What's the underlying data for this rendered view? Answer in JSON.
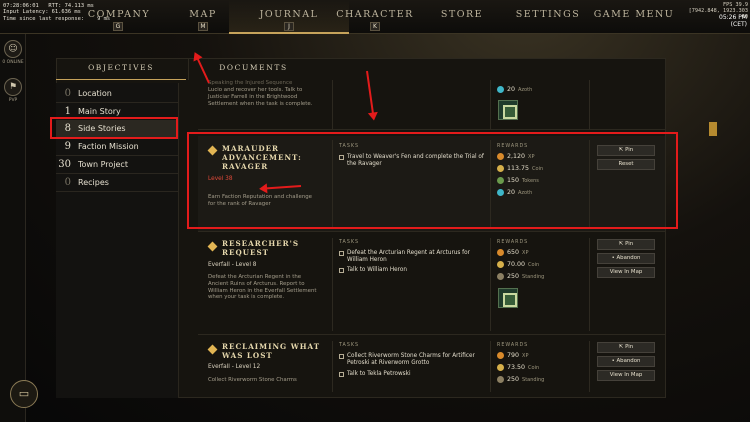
{
  "debug": {
    "lines": [
      "07:28:06:01   RTT: 74.113 ms",
      "Input Latency: 61.636 ms",
      "Time since last response:    9 ms"
    ]
  },
  "fps": {
    "lines": [
      "FPS 39.9",
      "[7942.848, 1923.303",
      "00"
    ]
  },
  "clock": {
    "time": "05:26 PM",
    "zone": "(CET)"
  },
  "nav": [
    {
      "label": "COMPANY",
      "key": "G"
    },
    {
      "label": "MAP",
      "key": "M"
    },
    {
      "label": "JOURNAL",
      "key": "J"
    },
    {
      "label": "CHARACTER",
      "key": "K"
    },
    {
      "label": "STORE",
      "key": ""
    },
    {
      "label": "SETTINGS",
      "key": ""
    },
    {
      "label": "GAME MENU",
      "key": ""
    }
  ],
  "leftbar": {
    "online": "0 ONLINE",
    "mode": "PVP"
  },
  "tabs": {
    "objectives": "OBJECTIVES",
    "documents": "DOCUMENTS"
  },
  "objectives": [
    {
      "count": "0",
      "label": "Location",
      "dim": true
    },
    {
      "count": "1",
      "label": "Main Story",
      "dim": false
    },
    {
      "count": "8",
      "label": "Side Stories",
      "dim": false
    },
    {
      "count": "9",
      "label": "Faction Mission",
      "dim": false
    },
    {
      "count": "30",
      "label": "Town Project",
      "dim": false
    },
    {
      "count": "0",
      "label": "Recipes",
      "dim": true
    }
  ],
  "quest0": {
    "desc": "Lucio and recover her tools. Talk to Justiciar Farrell in the Brightwood Settlement when the task is complete.",
    "cut": "Speaking the Injured Sequence",
    "azoth": "20",
    "azoth_label": "Azoth"
  },
  "quest1": {
    "title1": "MARAUDER",
    "title2": "ADVANCEMENT:",
    "title3": "RAVAGER",
    "level": "Level 38",
    "desc": "Earn Faction Reputation and challenge for the rank of Ravager",
    "tasks_head": "TASKS",
    "task1": "Travel to Weaver's Fen and complete the Trial of the Ravager",
    "rewards_head": "REWARDS",
    "xp": "2,120",
    "xp_label": "XP",
    "coin": "113.75",
    "coin_label": "Coin",
    "tokens": "150",
    "tokens_label": "Tokens",
    "azoth": "20",
    "azoth_label": "Azoth",
    "btn_pin": "Pin",
    "btn_reset": "Reset"
  },
  "quest2": {
    "title1": "RESEARCHER'S",
    "title2": "REQUEST",
    "sub": "Everfall - Level 8",
    "desc": "Defeat the Arcturian Regent in the Ancient Ruins of Arcturus. Report to William Heron in the Everfall Settlement when your task is complete.",
    "tasks_head": "TASKS",
    "task1": "Defeat the Arcturian Regent at Arcturus for William Heron",
    "task2": "Talk to William Heron",
    "rewards_head": "REWARDS",
    "xp": "650",
    "xp_label": "XP",
    "coin": "70.00",
    "coin_label": "Coin",
    "standing": "250",
    "standing_label": "Standing",
    "btn_pin": "Pin",
    "btn_abandon": "Abandon",
    "btn_map": "View In Map"
  },
  "quest3": {
    "title1": "RECLAIMING WHAT",
    "title2": "WAS LOST",
    "sub": "Everfall - Level 12",
    "desc": "Collect Riverworm Stone Charms",
    "tasks_head": "TASKS",
    "task1": "Collect Riverworm Stone Charms for Artificer Petroski at Riverworm Grotto",
    "task2": "Talk to Tekla Petrowski",
    "rewards_head": "REWARDS",
    "xp": "790",
    "xp_label": "XP",
    "coin": "73.50",
    "coin_label": "Coin",
    "standing": "250",
    "standing_label": "Standing",
    "btn_pin": "Pin",
    "btn_abandon": "Abandon",
    "btn_map": "View In Map"
  },
  "colors": {
    "accent": "#c6a35b",
    "annotation": "#e31b1b",
    "level": "#e34a3a"
  }
}
